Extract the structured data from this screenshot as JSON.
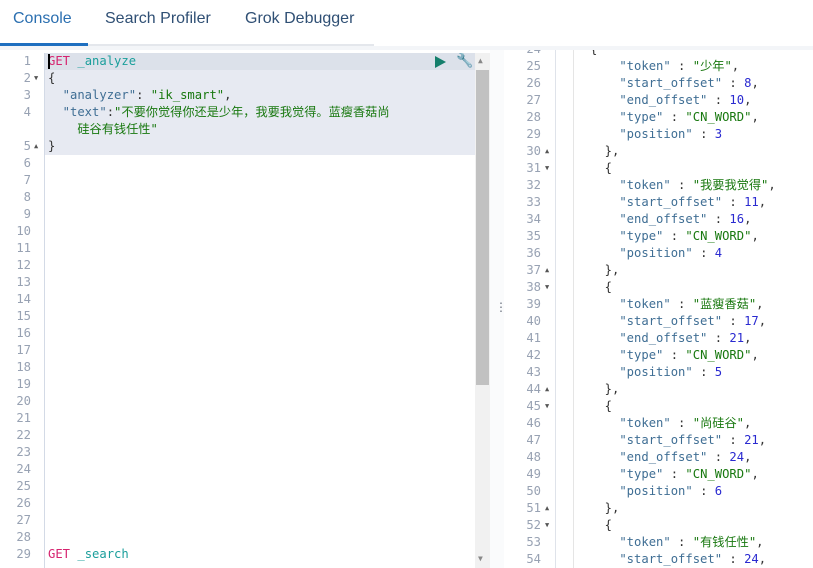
{
  "tabs": [
    {
      "label": "Console",
      "active": true
    },
    {
      "label": "Search Profiler"
    },
    {
      "label": "Grok Debugger"
    }
  ],
  "request_editor": {
    "actions": {
      "run": "play-icon",
      "settings": "wrench-icon"
    },
    "lines": [
      {
        "n": "1",
        "parts": [
          {
            "t": "GET",
            "c": "g"
          },
          {
            "t": " _analyze",
            "c": "u"
          }
        ]
      },
      {
        "n": "2",
        "fold": "down",
        "parts": [
          {
            "t": "{",
            "c": "p"
          }
        ]
      },
      {
        "n": "3",
        "parts": [
          {
            "t": "  \"analyzer\"",
            "c": "k"
          },
          {
            "t": ": ",
            "c": "p"
          },
          {
            "t": "\"ik_smart\"",
            "c": "s"
          },
          {
            "t": ",",
            "c": "p"
          }
        ]
      },
      {
        "n": "4",
        "parts": [
          {
            "t": "  \"text\"",
            "c": "k"
          },
          {
            "t": ":",
            "c": "p"
          },
          {
            "t": "\"不要你觉得你还是少年，我要我觉得。蓝瘦香菇尚",
            "c": "s"
          }
        ]
      },
      {
        "n": "",
        "parts": [
          {
            "t": "    硅谷有钱任性\"",
            "c": "s"
          }
        ]
      },
      {
        "n": "5",
        "fold": "up",
        "parts": [
          {
            "t": "}",
            "c": "p"
          }
        ]
      },
      {
        "n": "6"
      },
      {
        "n": "7"
      },
      {
        "n": "8"
      },
      {
        "n": "9"
      },
      {
        "n": "10"
      },
      {
        "n": "11"
      },
      {
        "n": "12"
      },
      {
        "n": "13"
      },
      {
        "n": "14"
      },
      {
        "n": "15"
      },
      {
        "n": "16"
      },
      {
        "n": "17"
      },
      {
        "n": "18"
      },
      {
        "n": "19"
      },
      {
        "n": "20"
      },
      {
        "n": "21"
      },
      {
        "n": "22"
      },
      {
        "n": "23"
      },
      {
        "n": "24"
      },
      {
        "n": "25"
      },
      {
        "n": "26"
      },
      {
        "n": "27"
      },
      {
        "n": "28"
      },
      {
        "n": "29",
        "parts": [
          {
            "t": "GET",
            "c": "g"
          },
          {
            "t": " _search",
            "c": "u"
          }
        ]
      }
    ]
  },
  "response_editor": {
    "lines": [
      {
        "n": "25",
        "parts": [
          {
            "t": "    \"token\"",
            "c": "k"
          },
          {
            "t": " : ",
            "c": "p"
          },
          {
            "t": "\"少年\"",
            "c": "s"
          },
          {
            "t": ",",
            "c": "p"
          }
        ]
      },
      {
        "n": "26",
        "parts": [
          {
            "t": "    \"start_offset\"",
            "c": "k"
          },
          {
            "t": " : ",
            "c": "p"
          },
          {
            "t": "8",
            "c": "n"
          },
          {
            "t": ",",
            "c": "p"
          }
        ]
      },
      {
        "n": "27",
        "parts": [
          {
            "t": "    \"end_offset\"",
            "c": "k"
          },
          {
            "t": " : ",
            "c": "p"
          },
          {
            "t": "10",
            "c": "n"
          },
          {
            "t": ",",
            "c": "p"
          }
        ]
      },
      {
        "n": "28",
        "parts": [
          {
            "t": "    \"type\"",
            "c": "k"
          },
          {
            "t": " : ",
            "c": "p"
          },
          {
            "t": "\"CN_WORD\"",
            "c": "s"
          },
          {
            "t": ",",
            "c": "p"
          }
        ]
      },
      {
        "n": "29",
        "parts": [
          {
            "t": "    \"position\"",
            "c": "k"
          },
          {
            "t": " : ",
            "c": "p"
          },
          {
            "t": "3",
            "c": "n"
          }
        ]
      },
      {
        "n": "30",
        "fold": "up",
        "parts": [
          {
            "t": "  },",
            "c": "p"
          }
        ]
      },
      {
        "n": "31",
        "fold": "down",
        "parts": [
          {
            "t": "  {",
            "c": "p"
          }
        ]
      },
      {
        "n": "32",
        "parts": [
          {
            "t": "    \"token\"",
            "c": "k"
          },
          {
            "t": " : ",
            "c": "p"
          },
          {
            "t": "\"我要我觉得\"",
            "c": "s"
          },
          {
            "t": ",",
            "c": "p"
          }
        ]
      },
      {
        "n": "33",
        "parts": [
          {
            "t": "    \"start_offset\"",
            "c": "k"
          },
          {
            "t": " : ",
            "c": "p"
          },
          {
            "t": "11",
            "c": "n"
          },
          {
            "t": ",",
            "c": "p"
          }
        ]
      },
      {
        "n": "34",
        "parts": [
          {
            "t": "    \"end_offset\"",
            "c": "k"
          },
          {
            "t": " : ",
            "c": "p"
          },
          {
            "t": "16",
            "c": "n"
          },
          {
            "t": ",",
            "c": "p"
          }
        ]
      },
      {
        "n": "35",
        "parts": [
          {
            "t": "    \"type\"",
            "c": "k"
          },
          {
            "t": " : ",
            "c": "p"
          },
          {
            "t": "\"CN_WORD\"",
            "c": "s"
          },
          {
            "t": ",",
            "c": "p"
          }
        ]
      },
      {
        "n": "36",
        "parts": [
          {
            "t": "    \"position\"",
            "c": "k"
          },
          {
            "t": " : ",
            "c": "p"
          },
          {
            "t": "4",
            "c": "n"
          }
        ]
      },
      {
        "n": "37",
        "fold": "up",
        "parts": [
          {
            "t": "  },",
            "c": "p"
          }
        ]
      },
      {
        "n": "38",
        "fold": "down",
        "parts": [
          {
            "t": "  {",
            "c": "p"
          }
        ]
      },
      {
        "n": "39",
        "parts": [
          {
            "t": "    \"token\"",
            "c": "k"
          },
          {
            "t": " : ",
            "c": "p"
          },
          {
            "t": "\"蓝瘦香菇\"",
            "c": "s"
          },
          {
            "t": ",",
            "c": "p"
          }
        ]
      },
      {
        "n": "40",
        "parts": [
          {
            "t": "    \"start_offset\"",
            "c": "k"
          },
          {
            "t": " : ",
            "c": "p"
          },
          {
            "t": "17",
            "c": "n"
          },
          {
            "t": ",",
            "c": "p"
          }
        ]
      },
      {
        "n": "41",
        "parts": [
          {
            "t": "    \"end_offset\"",
            "c": "k"
          },
          {
            "t": " : ",
            "c": "p"
          },
          {
            "t": "21",
            "c": "n"
          },
          {
            "t": ",",
            "c": "p"
          }
        ]
      },
      {
        "n": "42",
        "parts": [
          {
            "t": "    \"type\"",
            "c": "k"
          },
          {
            "t": " : ",
            "c": "p"
          },
          {
            "t": "\"CN_WORD\"",
            "c": "s"
          },
          {
            "t": ",",
            "c": "p"
          }
        ]
      },
      {
        "n": "43",
        "parts": [
          {
            "t": "    \"position\"",
            "c": "k"
          },
          {
            "t": " : ",
            "c": "p"
          },
          {
            "t": "5",
            "c": "n"
          }
        ]
      },
      {
        "n": "44",
        "fold": "up",
        "parts": [
          {
            "t": "  },",
            "c": "p"
          }
        ]
      },
      {
        "n": "45",
        "fold": "down",
        "parts": [
          {
            "t": "  {",
            "c": "p"
          }
        ]
      },
      {
        "n": "46",
        "parts": [
          {
            "t": "    \"token\"",
            "c": "k"
          },
          {
            "t": " : ",
            "c": "p"
          },
          {
            "t": "\"尚硅谷\"",
            "c": "s"
          },
          {
            "t": ",",
            "c": "p"
          }
        ]
      },
      {
        "n": "47",
        "parts": [
          {
            "t": "    \"start_offset\"",
            "c": "k"
          },
          {
            "t": " : ",
            "c": "p"
          },
          {
            "t": "21",
            "c": "n"
          },
          {
            "t": ",",
            "c": "p"
          }
        ]
      },
      {
        "n": "48",
        "parts": [
          {
            "t": "    \"end_offset\"",
            "c": "k"
          },
          {
            "t": " : ",
            "c": "p"
          },
          {
            "t": "24",
            "c": "n"
          },
          {
            "t": ",",
            "c": "p"
          }
        ]
      },
      {
        "n": "49",
        "parts": [
          {
            "t": "    \"type\"",
            "c": "k"
          },
          {
            "t": " : ",
            "c": "p"
          },
          {
            "t": "\"CN_WORD\"",
            "c": "s"
          },
          {
            "t": ",",
            "c": "p"
          }
        ]
      },
      {
        "n": "50",
        "parts": [
          {
            "t": "    \"position\"",
            "c": "k"
          },
          {
            "t": " : ",
            "c": "p"
          },
          {
            "t": "6",
            "c": "n"
          }
        ]
      },
      {
        "n": "51",
        "fold": "up",
        "parts": [
          {
            "t": "  },",
            "c": "p"
          }
        ]
      },
      {
        "n": "52",
        "fold": "down",
        "parts": [
          {
            "t": "  {",
            "c": "p"
          }
        ]
      },
      {
        "n": "53",
        "parts": [
          {
            "t": "    \"token\"",
            "c": "k"
          },
          {
            "t": " : ",
            "c": "p"
          },
          {
            "t": "\"有钱任性\"",
            "c": "s"
          },
          {
            "t": ",",
            "c": "p"
          }
        ]
      },
      {
        "n": "54",
        "parts": [
          {
            "t": "    \"start_offset\"",
            "c": "k"
          },
          {
            "t": " : ",
            "c": "p"
          },
          {
            "t": "24",
            "c": "n"
          },
          {
            "t": ",",
            "c": "p"
          }
        ]
      }
    ]
  }
}
